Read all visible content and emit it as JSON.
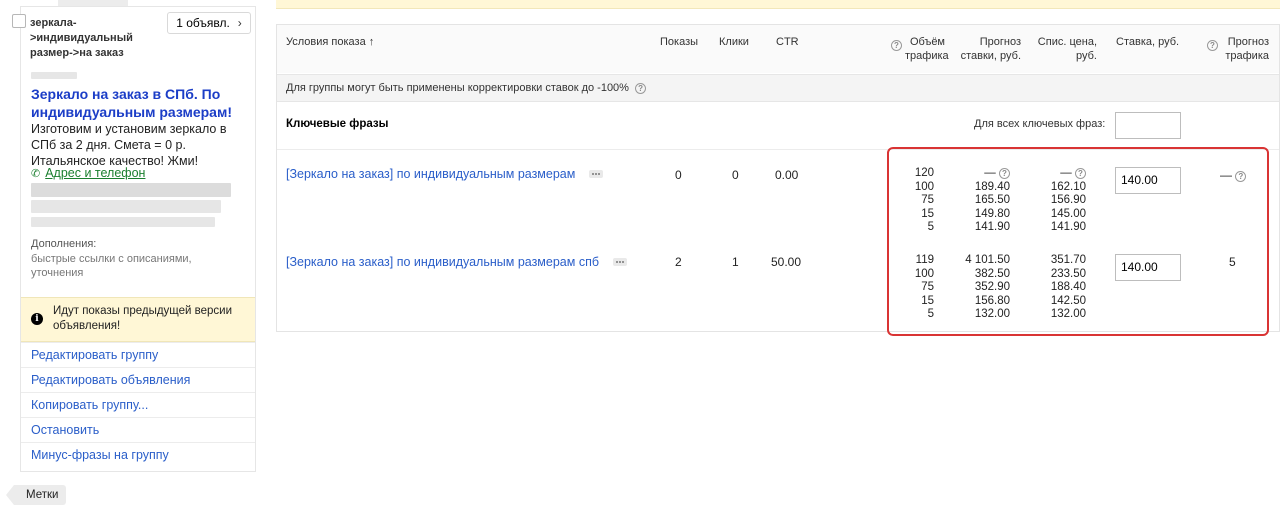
{
  "left": {
    "group_name": "зеркала-\n>индивидуальный\nразмер->на заказ",
    "ads_count": "1 объявл.",
    "ad_title": "Зеркало на заказ в СПб. По индивидуальным размерам!",
    "ad_text": "Изготовим и установим зеркало в СПб за 2 дня. Смета = 0 р. Итальянское качество! Жми!",
    "ad_link": "Адрес и телефон",
    "extras_title": "Дополнения:",
    "extras_text": "быстрые ссылки с описаниями, уточнения",
    "notice": "Идут показы предыдущей версии объявления!",
    "actions": [
      "Редактировать группу",
      "Редактировать объявления",
      "Копировать группу...",
      "Остановить",
      "Минус-фразы на группу"
    ],
    "tags": "Метки"
  },
  "table": {
    "headers": {
      "conditions": "Условия показа ↑",
      "impressions": "Показы",
      "clicks": "Клики",
      "ctr": "CTR",
      "traffic_volume": "Объём трафика",
      "bid_forecast": "Прогноз ставки, руб.",
      "charge_price": "Спис. цена, руб.",
      "bid": "Ставка, руб.",
      "traffic_forecast": "Прогноз трафика"
    },
    "group_note": "Для группы могут быть применены корректировки ставок до -100%",
    "section_title": "Ключевые фразы",
    "all_phrases_label": "Для всех ключевых фраз:",
    "all_phrases_value": "",
    "rows": [
      {
        "phrase": "[Зеркало на заказ] по индивидуальным размерам",
        "impressions": "0",
        "clicks": "0",
        "ctr": "0.00",
        "volume": [
          "120",
          "100",
          "75",
          "15",
          "5"
        ],
        "bid_forecast": [
          "—",
          "189.40",
          "165.50",
          "149.80",
          "141.90"
        ],
        "charge_price": [
          "—",
          "162.10",
          "156.90",
          "145.00",
          "141.90"
        ],
        "bid": "140.00",
        "traffic_forecast": "—"
      },
      {
        "phrase": "[Зеркало на заказ] по индивидуальным размерам спб",
        "impressions": "2",
        "clicks": "1",
        "ctr": "50.00",
        "volume": [
          "119",
          "100",
          "75",
          "15",
          "5"
        ],
        "bid_forecast": [
          "4 101.50",
          "382.50",
          "352.90",
          "156.80",
          "132.00"
        ],
        "charge_price": [
          "351.70",
          "233.50",
          "188.40",
          "142.50",
          "132.00"
        ],
        "bid": "140.00",
        "traffic_forecast": "5"
      }
    ]
  },
  "colors": {
    "link": "#2a5ec9",
    "ad_title": "#1b3dc7",
    "ad_link": "#1a7f2e",
    "notice_bg": "#fff7d6",
    "highlight": "#d93434"
  }
}
